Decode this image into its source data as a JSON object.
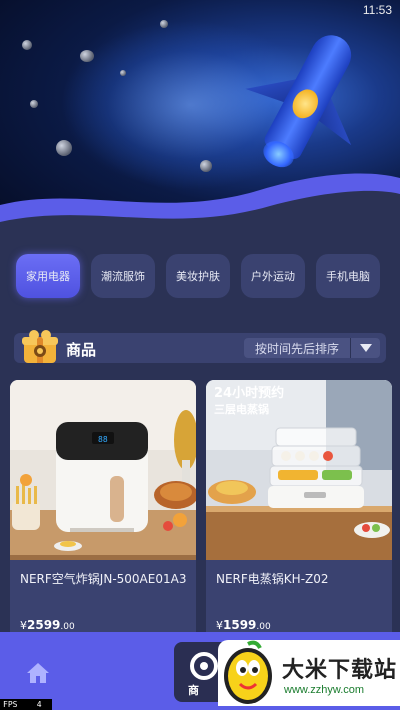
{
  "status_bar": {
    "time": "11:53"
  },
  "categories": [
    {
      "label": "家用电器",
      "active": true
    },
    {
      "label": "潮流服饰",
      "active": false
    },
    {
      "label": "美妆护肤",
      "active": false
    },
    {
      "label": "户外运动",
      "active": false
    },
    {
      "label": "手机电脑",
      "active": false
    }
  ],
  "section": {
    "title": "商品",
    "sort_label": "按时间先后排序",
    "icon": "gift-box-icon",
    "toggle_icon": "caret-down-icon"
  },
  "products": [
    {
      "name": "NERF空气炸锅JN-500AE01A3",
      "price_symbol": "¥",
      "price_int": "2599",
      "price_dec": ".00",
      "image": "air-fryer-image"
    },
    {
      "name": "NERF电蒸锅KH-Z02",
      "price_symbol": "¥",
      "price_int": "1599",
      "price_dec": ".00",
      "image": "steamer-image",
      "image_text_line1": "24小时预约",
      "image_text_line2": "三层电蒸锅"
    }
  ],
  "bottom_nav": {
    "home_icon": "home-icon",
    "center_label": "商"
  },
  "fps": {
    "label": "FPS",
    "value": "4"
  },
  "watermark": {
    "title": "大米下载站",
    "url": "www.zzhyw.com"
  },
  "colors": {
    "background": "#2b3255",
    "card": "#3a4270",
    "accent": "#5b5de8"
  }
}
